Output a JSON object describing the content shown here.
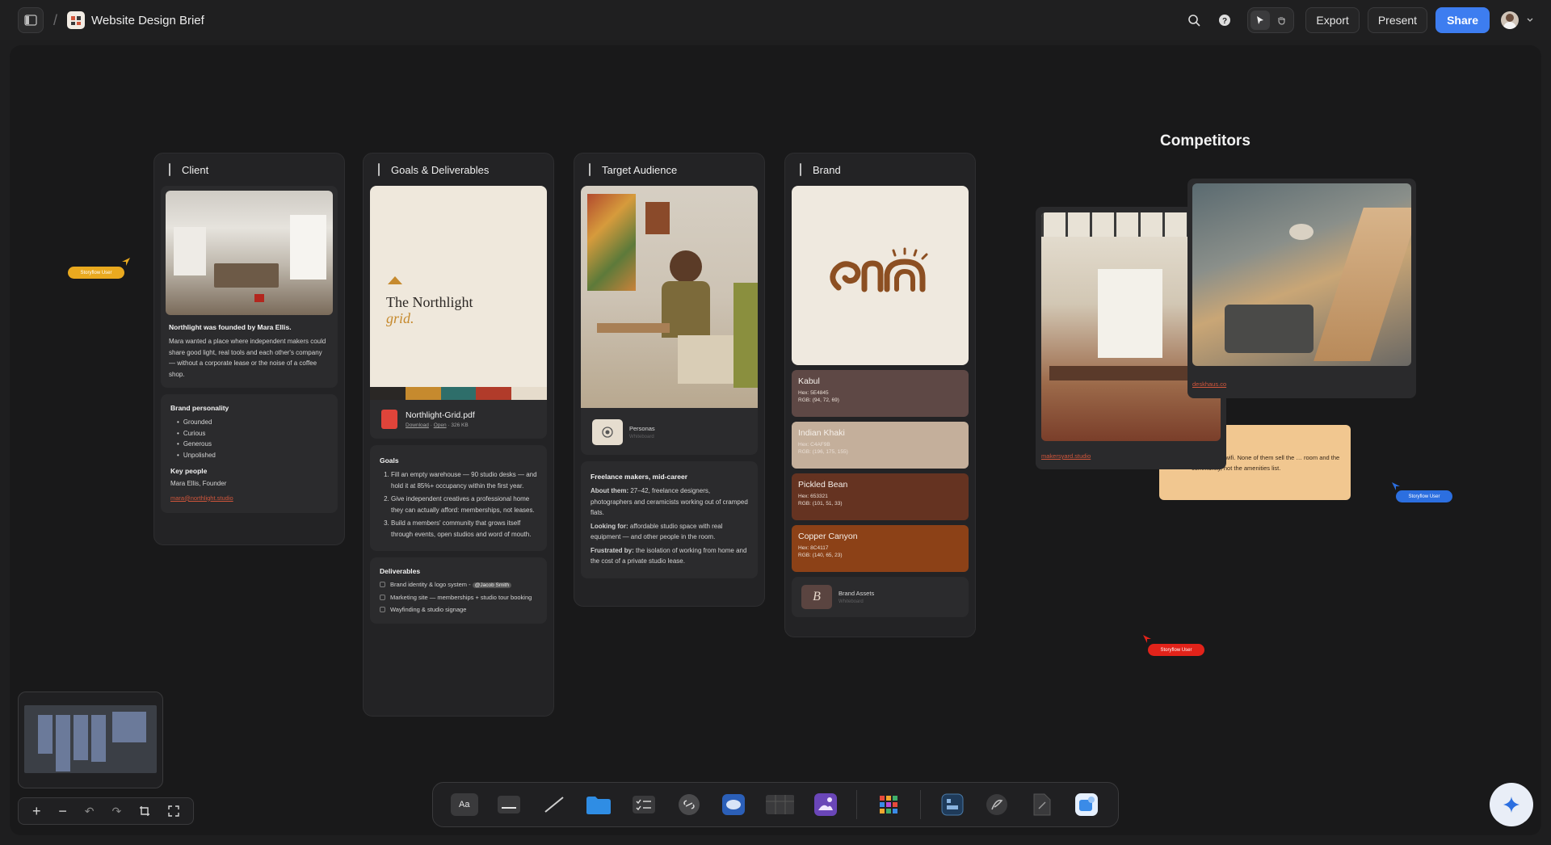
{
  "topbar": {
    "title": "Website Design Brief",
    "separator": "/",
    "export": "Export",
    "present": "Present",
    "share": "Share"
  },
  "columns": {
    "client": {
      "heading": "Client",
      "intro_title": "Northlight was founded by Mara Ellis.",
      "intro_body": "Mara wanted a place where independent makers could share good light, real tools and each other's company — without a corporate lease or the noise of a coffee shop.",
      "personality_title": "Brand personality",
      "personality": [
        "Grounded",
        "Curious",
        "Generous",
        "Unpolished"
      ],
      "key_people_title": "Key people",
      "key_person": "Mara Ellis, Founder",
      "email": "mara@northlight.studio"
    },
    "goals": {
      "heading": "Goals & Deliverables",
      "pdf_name": "Northlight-Grid.pdf",
      "pdf_download": "Download",
      "pdf_open": "Open",
      "pdf_size": "326 KB",
      "cover_title": "The Northlight",
      "cover_title_em": "grid.",
      "goals_title": "Goals",
      "goals": [
        "Fill an empty warehouse — 90 studio desks — and hold it at 85%+ occupancy within the first year.",
        "Give independent creatives a professional home they can actually afford: memberships, not leases.",
        "Build a members' community that grows itself through events, open studios and word of mouth."
      ],
      "deliverables_title": "Deliverables",
      "deliverables": [
        {
          "text": "Brand identity & logo system -",
          "mention": "@Jacob Smith"
        },
        {
          "text": "Marketing site — memberships + studio tour booking",
          "mention": ""
        },
        {
          "text": "Wayfinding & studio signage",
          "mention": ""
        }
      ]
    },
    "audience": {
      "heading": "Target Audience",
      "personas_label": "Personas",
      "personas_sub": "Whiteboard",
      "segment": "Freelance makers, mid-career",
      "about_label": "About them:",
      "about": "27–42, freelance designers, photographers and ceramicists working out of cramped flats.",
      "looking_label": "Looking for:",
      "looking": "affordable studio space with real equipment — and other people in the room.",
      "frustrated_label": "Frustrated by:",
      "frustrated": "the isolation of working from home and the cost of a private studio lease."
    },
    "brand": {
      "heading": "Brand",
      "swatches": [
        {
          "name": "Kabul",
          "hex": "Hex: 5E4845",
          "rgb": "RGB: (94, 72, 69)",
          "color": "#5e4845"
        },
        {
          "name": "Indian Khaki",
          "hex": "Hex: C4AF9B",
          "rgb": "RGB: (196, 175, 155)",
          "color": "#c4af9b"
        },
        {
          "name": "Pickled Bean",
          "hex": "Hex: 653321",
          "rgb": "RGB: (101, 51, 33)",
          "color": "#653321"
        },
        {
          "name": "Copper Canyon",
          "hex": "Hex: 8C4117",
          "rgb": "RGB: (140, 65, 23)",
          "color": "#8c4117"
        }
      ],
      "assets_label": "Brand Assets",
      "assets_sub": "Whiteboard"
    }
  },
  "competitors": {
    "title": "Competitors",
    "link1": "makersyard.studio",
    "link2": "deskhaus.co",
    "note": "ells desks + wifi. None of them sell the … room and the community, not the amenities list."
  },
  "cursors": [
    {
      "label": "Storyflow User",
      "color": "#e9a91f"
    },
    {
      "label": "Storyflow User",
      "color": "#2c6fe0"
    },
    {
      "label": "Storyflow User",
      "color": "#e2231a"
    }
  ],
  "toolbar": {
    "text_tool": "Aa"
  }
}
